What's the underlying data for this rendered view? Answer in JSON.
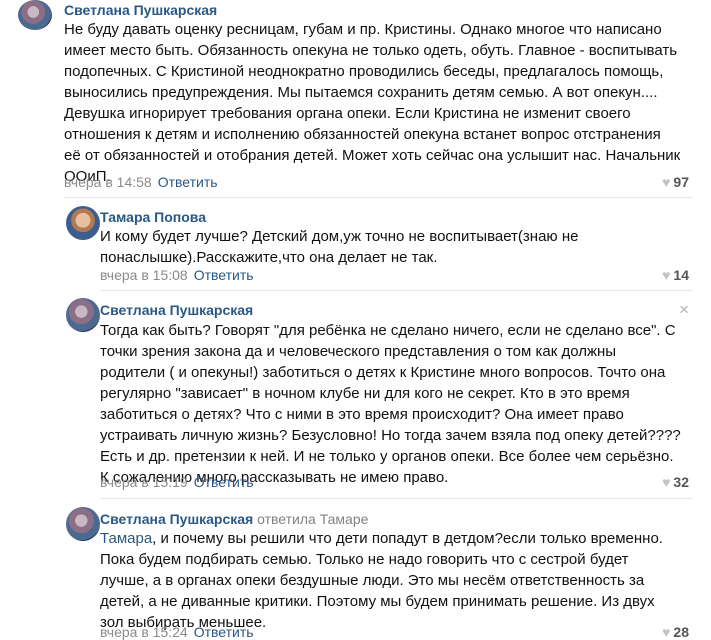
{
  "comments": [
    {
      "author": "Светлана Пушкарская",
      "lines": [
        "Не буду давать оценку ресницам, губам и пр. Кристины. Однако многое что написано",
        "имеет место быть. Обязанность опекуна не только одеть, обуть. Главное - воспитывать",
        "подопечных. С Кристиной неоднократно проводились беседы, предлагалось помощь,",
        "выносились предупреждения. Мы пытаемся сохранить детям семью. А вот опекун....",
        "Девушка игнорирует требования органа опеки. Если Кристина не изменит своего",
        "отношения к детям и исполнению обязанностей опекуна встанет вопрос отстранения",
        "её от обязанностей и отобрания детей. Может хоть сейчас она услышит нас. Начальник",
        "ООиП."
      ],
      "time": "вчера в 14:58",
      "reply_label": "Ответить",
      "likes": "97"
    },
    {
      "author": "Тамара Попова",
      "lines": [
        "И кому будет лучше? Детский дом,уж точно не воспитывает(знаю не",
        "понаслышке).Расскажите,что она делает не так."
      ],
      "time": "вчера в 15:08",
      "reply_label": "Ответить",
      "likes": "14"
    },
    {
      "author": "Светлана Пушкарская",
      "close_icon": "×",
      "lines": [
        "Тогда как быть? Говорят \"для ребёнка не сделано ничего, если не сделано все\". С",
        "точки зрения закона да и человеческого представления о том как должны",
        "родители ( и опекуны!) заботиться о детях к Кристине много вопросов. Точто она",
        "регулярно \"зависает\" в ночном клубе ни для кого не секрет. Кто в это время",
        "заботиться о детях? Что с ними в это время происходит? Она имеет право",
        "устраивать личную жизнь? Безусловно! Но тогда зачем взяла под опеку детей????",
        "Есть и др. претензии к ней. И не только у органов опеки. Все более чем серьёзно.",
        "К сожалению много рассказывать не имею право."
      ],
      "time": "вчера в 15:19",
      "reply_label": "Ответить",
      "likes": "32"
    },
    {
      "author": "Светлана Пушкарская",
      "replied_to": "ответила Тамаре",
      "addressee": "Тамара",
      "first_line_rest": ", и почему вы решили что дети попадут в детдом?если только временно.",
      "lines": [
        "Пока будем подбирать семью. Только не надо говорить что с сестрой будет",
        "лучше, а в органах опеки бездушные люди. Это мы несём ответственность за",
        "детей, а не диванные критики. Поэтому мы будем принимать решение. Из двух",
        "зол выбирать меньшее."
      ],
      "time": "вчера в 15:24",
      "reply_label": "Ответить",
      "likes": "28"
    }
  ]
}
